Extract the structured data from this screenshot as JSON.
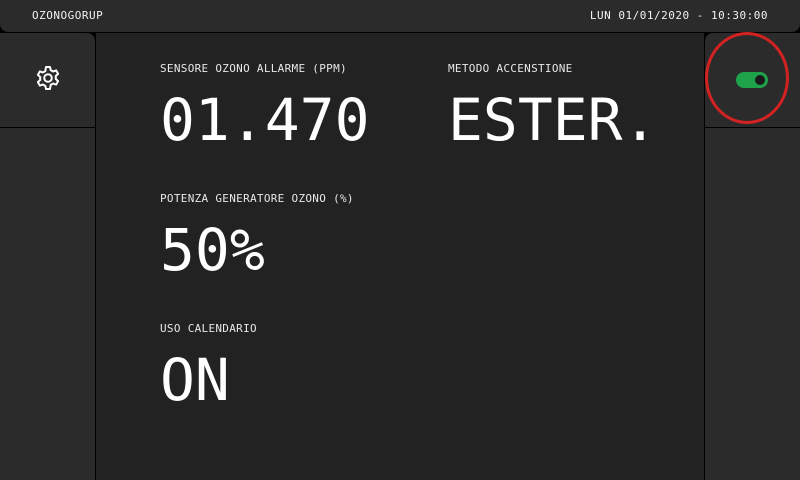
{
  "header": {
    "brand": "OZONOGORUP",
    "datetime": "LUN 01/01/2020 - 10:30:00"
  },
  "sidebar_left": {
    "settings_icon": "gear-icon"
  },
  "sidebar_right": {
    "toggle_icon": "toggle-switch-icon",
    "toggle_state": "on",
    "toggle_color": "#1fa34a",
    "highlight_color": "#d32222"
  },
  "fields": {
    "ozone_sensor": {
      "label": "SENSORE OZONO ALLARME (PPM)",
      "value": "01.470"
    },
    "ignition_method": {
      "label": "METODO ACCENSTIONE",
      "value": "ESTER."
    },
    "generator_power": {
      "label": "POTENZA GENERATORE OZONO (%)",
      "value": "50%"
    },
    "calendar_use": {
      "label": "USO CALENDARIO",
      "value": "ON"
    }
  }
}
